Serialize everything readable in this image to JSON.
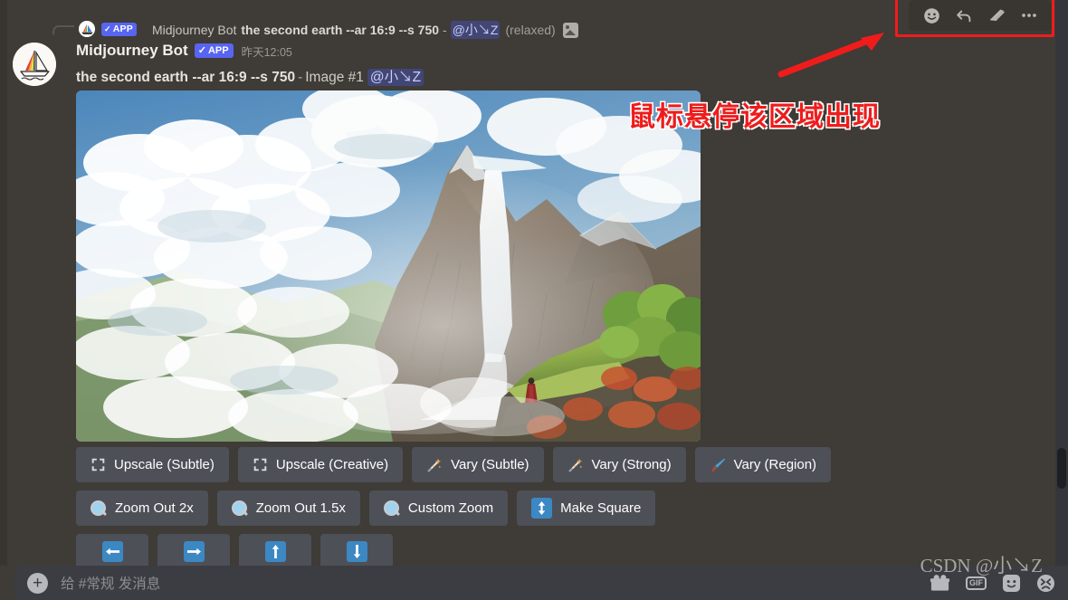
{
  "reply_preview": {
    "app_badge": "APP",
    "check": "✓",
    "bot_name": "Midjourney Bot",
    "prompt": "the second earth --ar 16:9 --s 750",
    "dash": "-",
    "mention": "@小↘Z",
    "status": "(relaxed)",
    "attachment_icon": "image-icon"
  },
  "hover_toolbar": {
    "items": [
      {
        "name": "add-reaction-icon",
        "label": "Add Reaction"
      },
      {
        "name": "reply-icon",
        "label": "Reply"
      },
      {
        "name": "thread-icon",
        "label": "Create Thread"
      },
      {
        "name": "more-icon",
        "label": "More"
      }
    ]
  },
  "message": {
    "author": "Midjourney Bot",
    "app_badge": "APP",
    "check": "✓",
    "timestamp": "昨天12:05",
    "prompt": "the second earth --ar 16:9 --s 750",
    "separator": "-",
    "image_label": "Image #1",
    "mention": "@小↘Z"
  },
  "annotation": {
    "text": "鼠标悬停该区域出现",
    "color": "#ee1c1c",
    "arrow": "red-arrow"
  },
  "artwork": {
    "alt": "fantasy landscape with waterfall, clouds and lone figure in red cloak",
    "palette": {
      "sky": "#5b93c4",
      "cloud": "#f2f4f3",
      "rock": "#7d6f5f",
      "grass": "#a9c256",
      "water": "#e9f2f5",
      "cloak": "#8e2a28"
    }
  },
  "action_buttons": {
    "rows": [
      [
        {
          "label": "Upscale (Subtle)",
          "icon": "expand-icon",
          "name": "upscale-subtle-button"
        },
        {
          "label": "Upscale (Creative)",
          "icon": "expand-icon",
          "name": "upscale-creative-button"
        },
        {
          "label": "Vary (Subtle)",
          "icon": "sparkle-wand-icon",
          "name": "vary-subtle-button"
        },
        {
          "label": "Vary (Strong)",
          "icon": "sparkle-wand-icon",
          "name": "vary-strong-button"
        },
        {
          "label": "Vary (Region)",
          "icon": "paintbrush-icon",
          "name": "vary-region-button"
        }
      ],
      [
        {
          "label": "Zoom Out 2x",
          "icon": "magnifier-icon",
          "name": "zoom-out-2x-button"
        },
        {
          "label": "Zoom Out 1.5x",
          "icon": "magnifier-icon",
          "name": "zoom-out-1-5x-button"
        },
        {
          "label": "Custom Zoom",
          "icon": "magnifier-icon",
          "name": "custom-zoom-button"
        },
        {
          "label": "Make Square",
          "icon": "updown-arrow-icon",
          "name": "make-square-button"
        }
      ],
      [
        {
          "label": "",
          "icon": "arrow-left-icon",
          "glyph": "←",
          "name": "pan-left-button"
        },
        {
          "label": "",
          "icon": "arrow-right-icon",
          "glyph": "→",
          "name": "pan-right-button"
        },
        {
          "label": "",
          "icon": "arrow-up-icon",
          "glyph": "↑",
          "name": "pan-up-button"
        },
        {
          "label": "",
          "icon": "arrow-down-icon",
          "glyph": "↓",
          "name": "pan-down-button"
        }
      ]
    ]
  },
  "composer": {
    "plus": "+",
    "placeholder": "给 #常规 发消息",
    "icons": [
      {
        "name": "gift-icon",
        "label": "Gift"
      },
      {
        "name": "gif-icon",
        "label": "GIF"
      },
      {
        "name": "sticker-icon",
        "label": "Sticker"
      },
      {
        "name": "emoji-icon",
        "label": "Emoji"
      }
    ]
  },
  "watermark": {
    "text": "CSDN @小↘Z"
  },
  "colors": {
    "background": "#3f3b36",
    "button": "#4e5058",
    "blurple": "#5865f2",
    "mention_bg": "#414675",
    "annotation_red": "#ee1c1c",
    "composer_bg": "#3b3d43"
  }
}
